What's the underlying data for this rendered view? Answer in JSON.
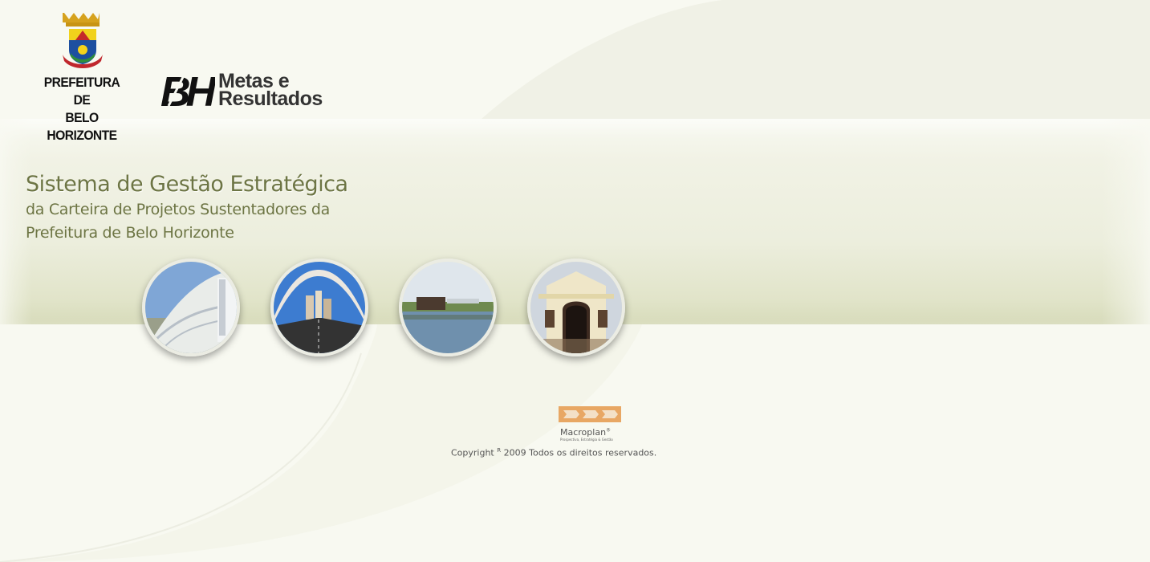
{
  "header": {
    "pbh_logo_lines": [
      "PREFEITURA DE",
      "BELO HORIZONTE"
    ],
    "brand_mark": "BH",
    "brand_lines": [
      "Metas e",
      "Resultados"
    ]
  },
  "heading": {
    "title": "Sistema de Gestão Estratégica",
    "subtitle_lines": [
      "da Carteira de Projetos Sustentadores da",
      "Prefeitura de Belo Horizonte"
    ]
  },
  "circles": [
    {
      "name": "photo-church"
    },
    {
      "name": "photo-bridge"
    },
    {
      "name": "photo-lake"
    },
    {
      "name": "photo-building"
    }
  ],
  "footer": {
    "macroplan_name": "Macroplan",
    "macroplan_reg": "®",
    "macroplan_tagline": "Prospectiva, Estratégia & Gestão",
    "copyright_prefix": "Copyright",
    "copyright_mark": "R",
    "copyright_suffix": "2009 Todos os direitos reservados."
  },
  "colors": {
    "background": "#f8f9f1",
    "title": "#6d7544",
    "macroplan_orange": "#e8a764"
  }
}
